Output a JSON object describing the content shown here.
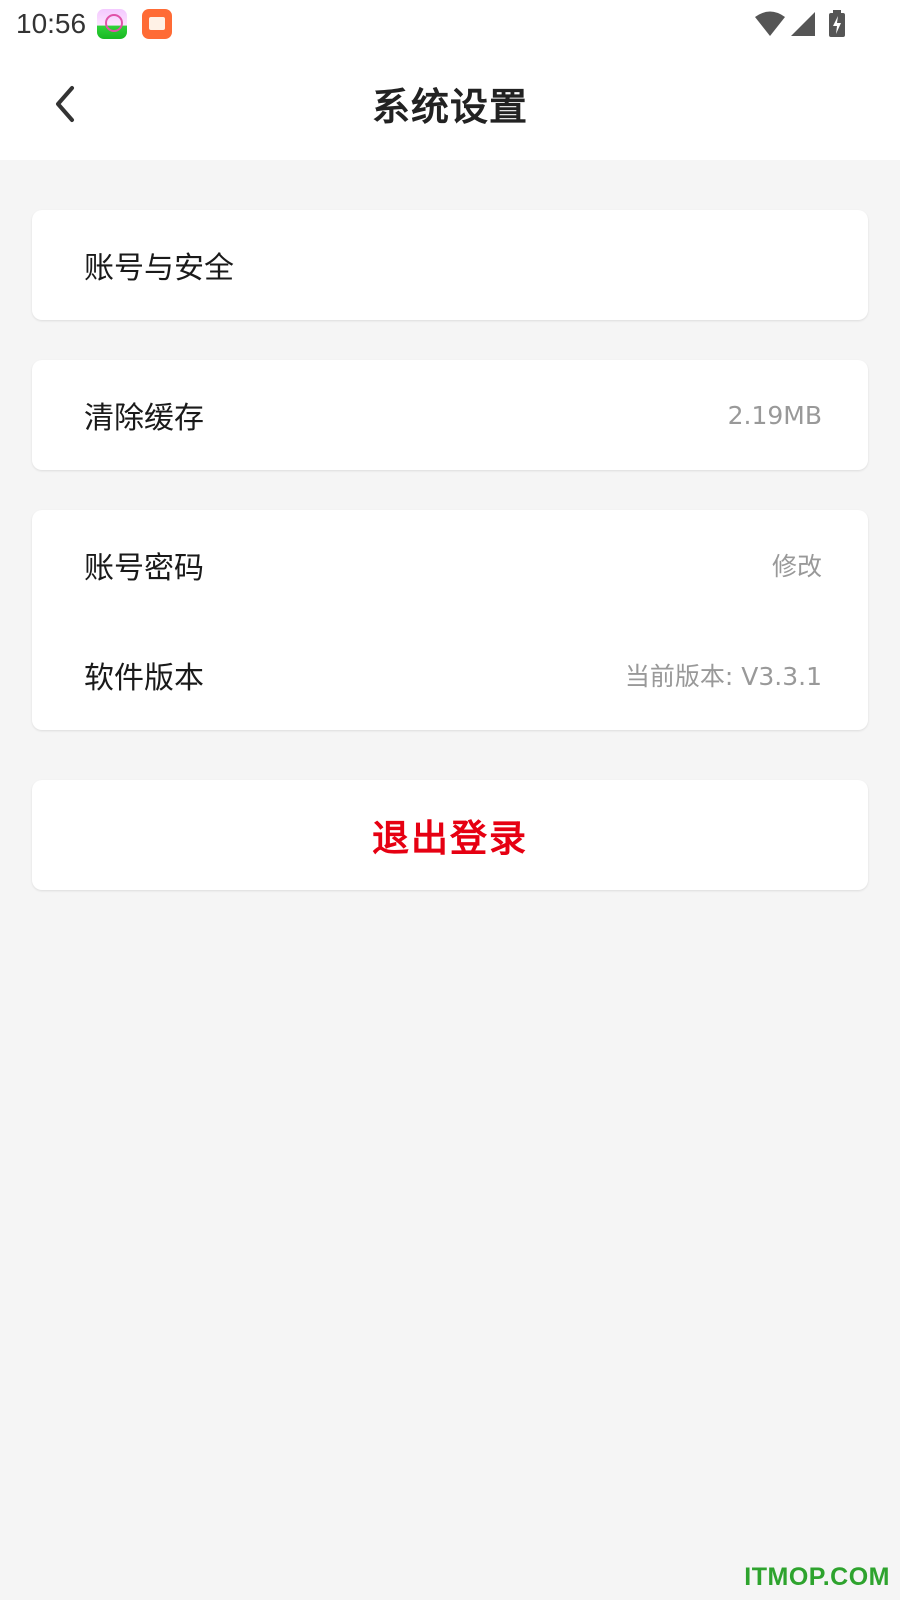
{
  "status_bar": {
    "time": "10:56",
    "icons": [
      "wifi-icon",
      "signal-icon",
      "battery-charging-icon"
    ]
  },
  "nav": {
    "title": "系统设置",
    "back_icon": "chevron-left-icon"
  },
  "settings": {
    "account_security": {
      "label": "账号与安全"
    },
    "clear_cache": {
      "label": "清除缓存",
      "value": "2.19MB"
    },
    "account_password": {
      "label": "账号密码",
      "value": "修改"
    },
    "software_version": {
      "label": "软件版本",
      "value": "当前版本: V3.3.1"
    }
  },
  "logout": {
    "label": "退出登录"
  },
  "watermark": "ITMOP.COM",
  "colors": {
    "background": "#f5f5f5",
    "card": "#ffffff",
    "logout_text": "#e60012",
    "secondary_text": "#999999",
    "watermark": "#2ea32e"
  }
}
